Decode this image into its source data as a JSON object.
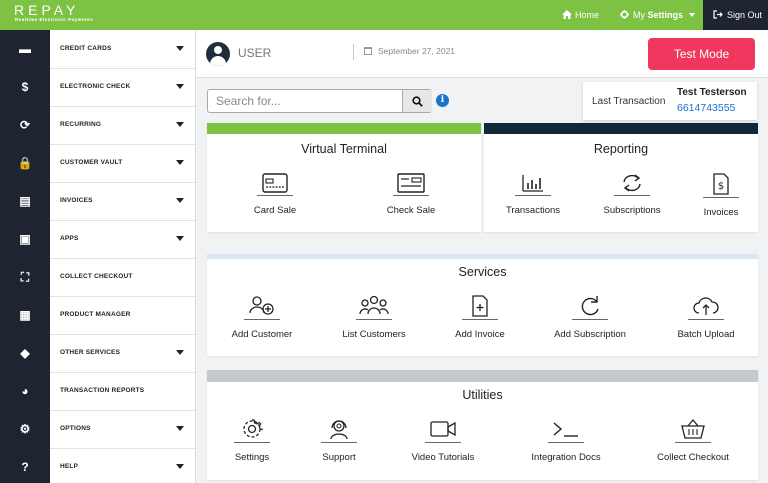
{
  "brand": {
    "name": "REPAY",
    "tagline": "Realtime Electronic Payments"
  },
  "topnav": {
    "home": "Home",
    "settings_prefix": "My ",
    "settings": "Settings",
    "signout": "Sign Out"
  },
  "sidebar": {
    "items": [
      {
        "label": "CREDIT CARDS",
        "icon": "credit-card-icon",
        "glyph": "▬",
        "caret": true
      },
      {
        "label": "ELECTRONIC CHECK",
        "icon": "dollar-icon",
        "glyph": "$",
        "caret": true
      },
      {
        "label": "RECURRING",
        "icon": "recurring-icon",
        "glyph": "⟳",
        "caret": true
      },
      {
        "label": "CUSTOMER VAULT",
        "icon": "lock-icon",
        "glyph": "🔒",
        "caret": true
      },
      {
        "label": "INVOICES",
        "icon": "invoice-icon",
        "glyph": "▤",
        "caret": true
      },
      {
        "label": "APPS",
        "icon": "apps-icon",
        "glyph": "▣",
        "caret": true
      },
      {
        "label": "COLLECT CHECKOUT",
        "icon": "basket-icon",
        "glyph": "⛶",
        "caret": false
      },
      {
        "label": "PRODUCT MANAGER",
        "icon": "boxes-icon",
        "glyph": "▦",
        "caret": false
      },
      {
        "label": "OTHER SERVICES",
        "icon": "tags-icon",
        "glyph": "◆",
        "caret": true
      },
      {
        "label": "TRANSACTION REPORTS",
        "icon": "pie-chart-icon",
        "glyph": "◕",
        "caret": false
      },
      {
        "label": "OPTIONS",
        "icon": "cogs-icon",
        "glyph": "⚙",
        "caret": true
      },
      {
        "label": "HELP",
        "icon": "question-icon",
        "glyph": "?",
        "caret": true
      }
    ]
  },
  "header": {
    "user": "USER",
    "date": "September 27, 2021",
    "test_mode": "Test Mode"
  },
  "search": {
    "placeholder": "Search for..."
  },
  "last_transaction": {
    "label": "Last Transaction",
    "name": "Test Testerson",
    "phone": "6614743555"
  },
  "sections": {
    "virtual_terminal": {
      "title": "Virtual Terminal",
      "bar_color": "#7dc243",
      "actions": [
        "Card Sale",
        "Check Sale"
      ]
    },
    "reporting": {
      "title": "Reporting",
      "bar_color": "#11283b",
      "actions": [
        "Transactions",
        "Subscriptions",
        "Invoices"
      ]
    },
    "services": {
      "title": "Services",
      "bar_color": "#dbe8f3",
      "actions": [
        "Add Customer",
        "List Customers",
        "Add Invoice",
        "Add Subscription",
        "Batch Upload"
      ]
    },
    "utilities": {
      "title": "Utilities",
      "bar_color": "#c6c9cc",
      "actions": [
        "Settings",
        "Support",
        "Video Tutorials",
        "Integration Docs",
        "Collect Checkout"
      ]
    }
  },
  "colors": {
    "green": "#7dc243",
    "navy": "#1e2530",
    "accent": "#f0385f",
    "link": "#1a73c9"
  }
}
